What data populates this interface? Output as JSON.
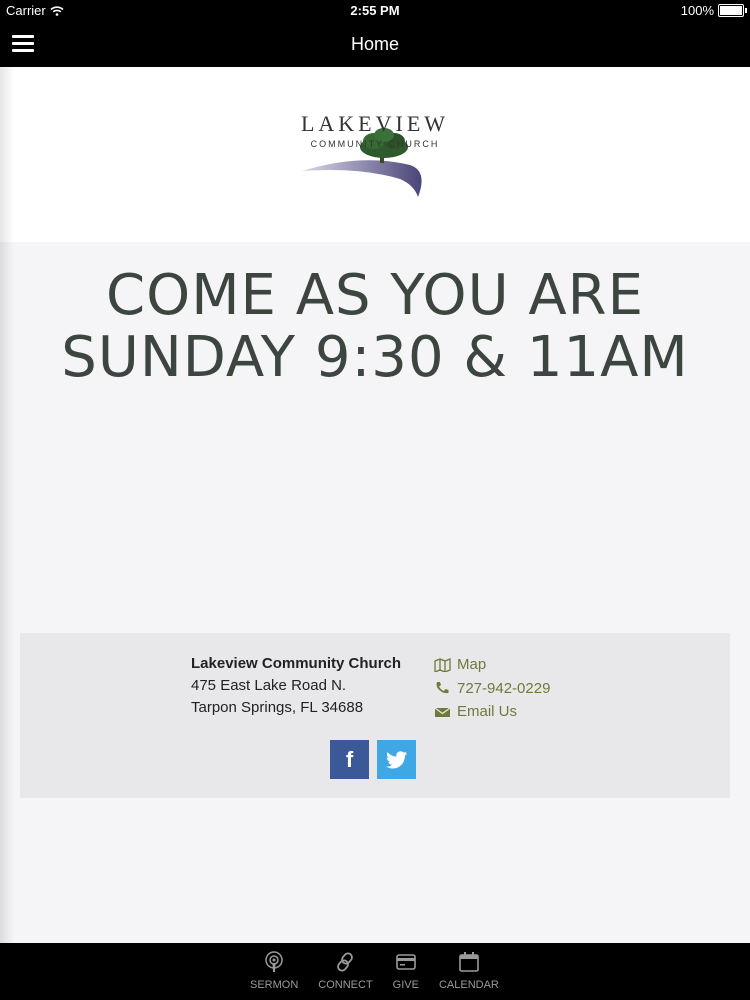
{
  "status_bar": {
    "carrier": "Carrier",
    "time": "2:55 PM",
    "battery": "100%"
  },
  "nav": {
    "title": "Home"
  },
  "logo": {
    "line1": "LAKEVIEW",
    "line2": "COMMUNITY CHURCH"
  },
  "hero": {
    "line1": "COME AS YOU ARE",
    "line2": "SUNDAY 9:30 & 11AM"
  },
  "footer": {
    "church_name": "Lakeview Community Church",
    "address1": "475 East Lake Road N.",
    "address2": "Tarpon Springs, FL 34688",
    "map_label": "Map",
    "phone": "727-942-0229",
    "email_label": "Email Us",
    "facebook_label": "f"
  },
  "tabs": [
    {
      "label": "SERMON",
      "icon": "podcast-icon"
    },
    {
      "label": "CONNECT",
      "icon": "link-icon"
    },
    {
      "label": "GIVE",
      "icon": "credit-card-icon"
    },
    {
      "label": "CALENDAR",
      "icon": "calendar-icon"
    }
  ],
  "colors": {
    "accent": "#6f7a3a",
    "facebook": "#3b5998",
    "twitter": "#3fa7e3",
    "hero_text": "#3d4540"
  }
}
